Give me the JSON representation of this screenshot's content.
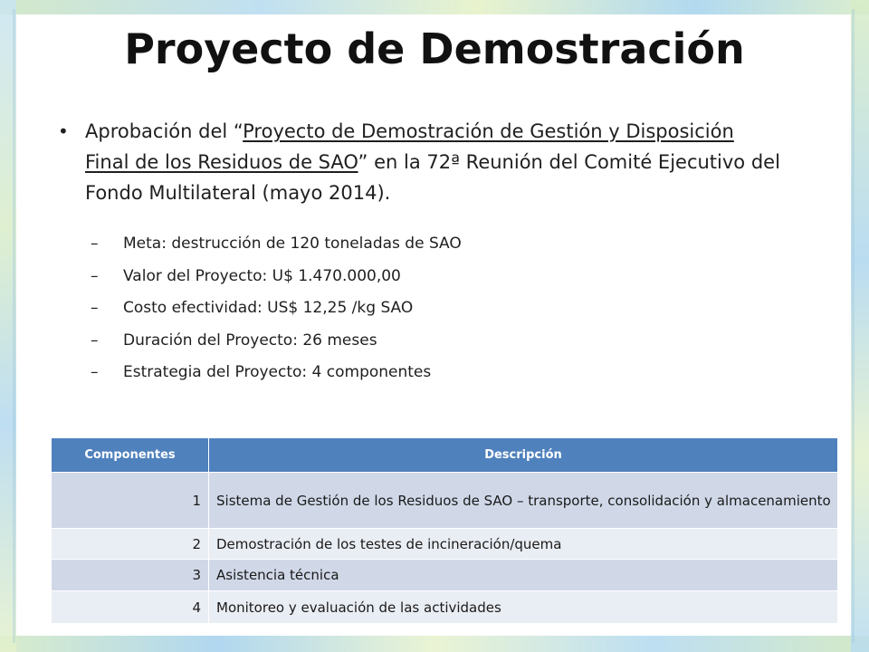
{
  "slide": {
    "title": "Proyecto de Demostración",
    "main_bullet": {
      "prefix": "Aprobación del “",
      "underlined": "Proyecto de Demostración de Gestión y Disposición Final de los Residuos de SAO",
      "suffix": "” en la 72ª Reunión del Comité Ejecutivo del Fondo Multilateral (mayo 2014)."
    },
    "sub_bullets": [
      "Meta:  destrucción de 120 toneladas de SAO",
      "Valor del Proyecto:  U$ 1.470.000,00",
      "Costo efectividad: US$ 12,25 /kg SAO",
      "Duración del Proyecto: 26 meses",
      "Estrategia del Proyecto: 4 componentes"
    ],
    "table": {
      "headers": [
        "Componentes",
        "Descripción"
      ],
      "rows": [
        [
          "1",
          "Sistema de Gestión de los Residuos de SAO – transporte, consolidación y almacenamiento"
        ],
        [
          "2",
          "Demostración de los testes de incineración/quema"
        ],
        [
          "3",
          "Asistencia técnica"
        ],
        [
          "4",
          "Monitoreo y evaluación de las actividades"
        ]
      ]
    }
  },
  "colors": {
    "header": "#4f81bd",
    "row_dark": "#d0d8e8",
    "row_light": "#e9edf4"
  }
}
